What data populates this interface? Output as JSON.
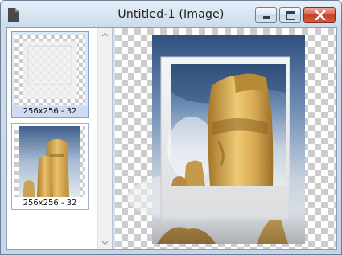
{
  "window": {
    "title": "Untitled-1 (Image)"
  },
  "icons": {
    "app": "document-icon",
    "minimize": "minimize-icon",
    "maximize": "maximize-icon",
    "close": "close-icon",
    "scroll_up": "chevron-up-icon",
    "scroll_down": "chevron-down-icon"
  },
  "thumbnails": [
    {
      "label": "256x256 - 32",
      "selected": true,
      "content": "frame-only-transparent"
    },
    {
      "label": "256x256 - 32",
      "selected": false,
      "content": "sculpture-photo"
    }
  ],
  "colors": {
    "titlebar": "#d8e4f2",
    "close_button": "#c4412a",
    "selection": "#dce8f7",
    "sky": "#4d6f9c",
    "stone": "#d9b25c"
  }
}
